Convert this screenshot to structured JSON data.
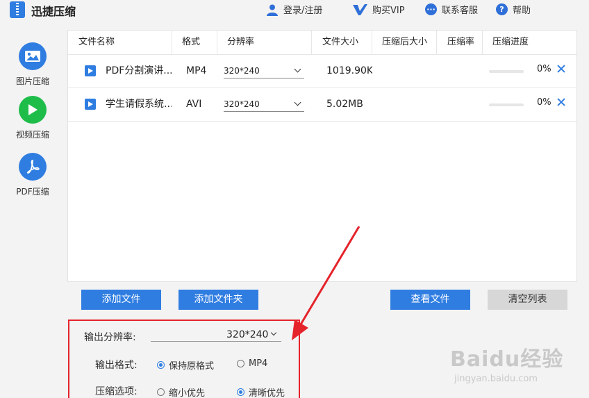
{
  "app": {
    "title": "迅捷压缩"
  },
  "topnav": {
    "login": "登录/注册",
    "vip": "购买VIP",
    "support": "联系客服",
    "help": "帮助"
  },
  "sidebar": {
    "items": [
      {
        "label": "图片压缩",
        "icon": "image-icon",
        "active": false
      },
      {
        "label": "视频压缩",
        "icon": "play-icon",
        "active": true
      },
      {
        "label": "PDF压缩",
        "icon": "pdf-icon",
        "active": false
      }
    ]
  },
  "table": {
    "headers": [
      "文件名称",
      "格式",
      "分辨率",
      "文件大小",
      "压缩后大小",
      "压缩率",
      "压缩进度"
    ],
    "rows": [
      {
        "name": "PDF分割演讲...",
        "format": "MP4",
        "resolution": "320*240",
        "size": "1019.90KE",
        "compressed_size": "",
        "ratio": "",
        "progress": 0,
        "progress_label": "0%"
      },
      {
        "name": "学生请假系统...",
        "format": "AVI",
        "resolution": "320*240",
        "size": "5.02MB",
        "compressed_size": "",
        "ratio": "",
        "progress": 0,
        "progress_label": "0%"
      }
    ]
  },
  "buttons": {
    "add_file": "添加文件",
    "add_folder": "添加文件夹",
    "view_files": "查看文件",
    "clear_list": "清空列表"
  },
  "options": {
    "resolution_label": "输出分辨率:",
    "resolution_value": "320*240",
    "format_label": "输出格式:",
    "format_options": [
      {
        "label": "保持原格式",
        "selected": true
      },
      {
        "label": "MP4",
        "selected": false
      }
    ],
    "compress_label": "压缩选项:",
    "compress_options": [
      {
        "label": "缩小优先",
        "selected": false
      },
      {
        "label": "清晰优先",
        "selected": true
      }
    ]
  },
  "watermark": {
    "main": "Baidu经验",
    "sub": "jingyan.baidu.com"
  },
  "colors": {
    "accent": "#2f7de1",
    "active_green": "#1ebd4a",
    "annotation_red": "#e5232b"
  }
}
